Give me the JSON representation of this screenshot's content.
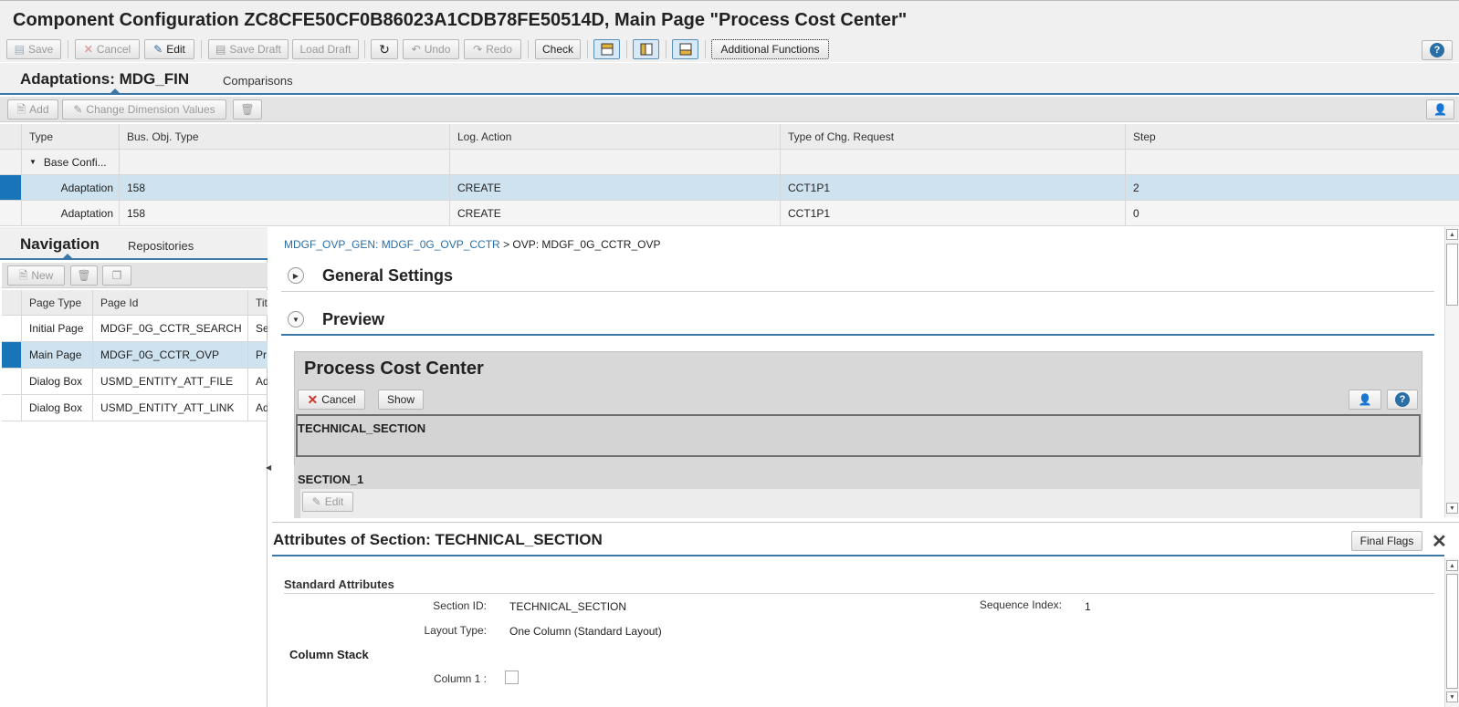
{
  "window": {
    "title": "Component Configuration ZC8CFE50CF0B86023A1CDB78FE50514D, Main Page \"Process Cost Center\""
  },
  "toolbar": {
    "save": "Save",
    "cancel": "Cancel",
    "edit": "Edit",
    "save_draft": "Save Draft",
    "load_draft": "Load Draft",
    "undo": "Undo",
    "redo": "Redo",
    "check": "Check",
    "additional_functions": "Additional Functions"
  },
  "adaptations": {
    "tab_active": "Adaptations: MDG_FIN",
    "tab_comparisons": "Comparisons",
    "add": "Add",
    "change_dimension_values": "Change Dimension Values",
    "columns": [
      "Type",
      "Bus. Obj. Type",
      "Log. Action",
      "Type of Chg. Request",
      "Step"
    ],
    "group_label": "Base Confi...",
    "rows": [
      {
        "type": "Adaptation",
        "bo_type": "158",
        "action": "CREATE",
        "chg_request": "CCT1P1",
        "step": "2",
        "selected": true
      },
      {
        "type": "Adaptation",
        "bo_type": "158",
        "action": "CREATE",
        "chg_request": "CCT1P1",
        "step": "0",
        "selected": false
      }
    ]
  },
  "navigation": {
    "tab_active": "Navigation",
    "tab_repositories": "Repositories",
    "new": "New",
    "columns": [
      "Page Type",
      "Page Id",
      "Tit"
    ],
    "rows": [
      {
        "page_type": "Initial Page",
        "page_id": "MDGF_0G_CCTR_SEARCH",
        "title": "Se",
        "selected": false
      },
      {
        "page_type": "Main Page",
        "page_id": "MDGF_0G_CCTR_OVP",
        "title": "Pr",
        "selected": true
      },
      {
        "page_type": "Dialog Box",
        "page_id": "USMD_ENTITY_ATT_FILE",
        "title": "Ad",
        "selected": false
      },
      {
        "page_type": "Dialog Box",
        "page_id": "USMD_ENTITY_ATT_LINK",
        "title": "Ad",
        "selected": false
      }
    ]
  },
  "content": {
    "breadcrumb_link": "MDGF_OVP_GEN: MDGF_0G_OVP_CCTR",
    "breadcrumb_sep": ">",
    "breadcrumb_current": "OVP: MDGF_0G_CCTR_OVP",
    "general_settings": "General Settings",
    "preview": "Preview",
    "preview_title": "Process Cost Center",
    "preview_cancel": "Cancel",
    "preview_show": "Show",
    "technical_section": "TECHNICAL_SECTION",
    "section_1": "SECTION_1",
    "section_edit": "Edit"
  },
  "attributes": {
    "title": "Attributes of Section: TECHNICAL_SECTION",
    "final_flags": "Final Flags",
    "standard_attributes": "Standard Attributes",
    "section_id_label": "Section ID:",
    "section_id_value": "TECHNICAL_SECTION",
    "sequence_index_label": "Sequence Index:",
    "sequence_index_value": "1",
    "layout_type_label": "Layout Type:",
    "layout_type_value": "One Column (Standard Layout)",
    "column_stack": "Column Stack",
    "column_1_label": "Column 1 :"
  },
  "colors": {
    "accent": "#3b78a8",
    "selected_row": "#cfe2f0",
    "selected_marker": "#1a74b8",
    "link": "#2a6ea6"
  }
}
